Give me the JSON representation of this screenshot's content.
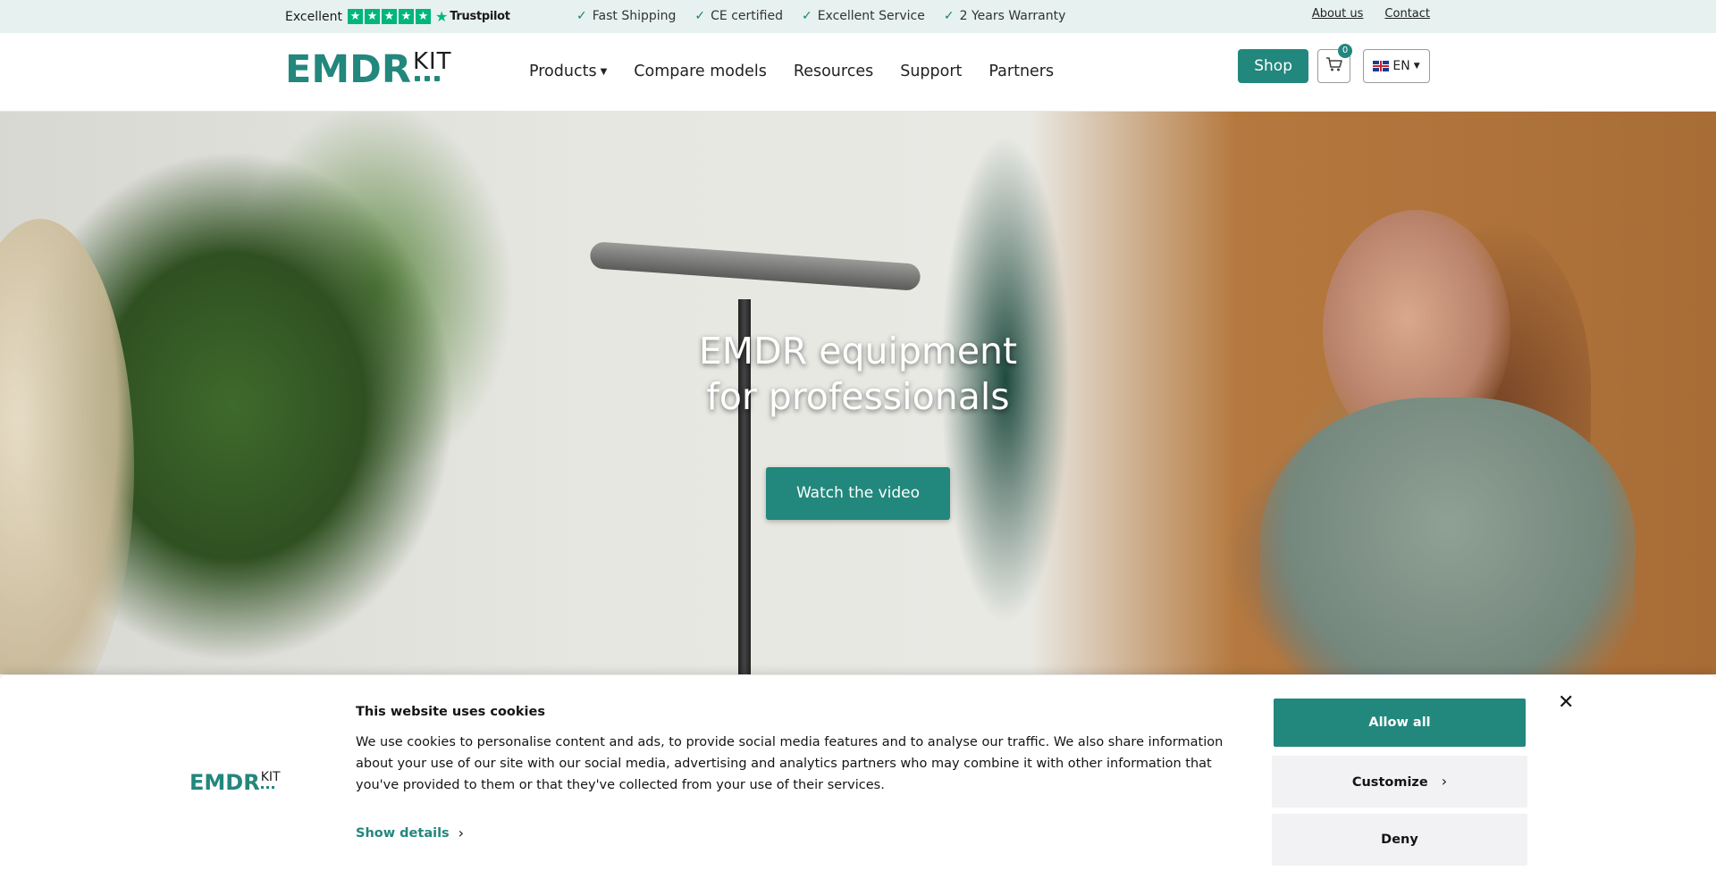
{
  "topbar": {
    "rating_word": "Excellent",
    "trustpilot": "Trustpilot",
    "usps": [
      "Fast Shipping",
      "CE certified",
      "Excellent Service",
      "2 Years Warranty"
    ],
    "links": {
      "about": "About us",
      "contact": "Contact"
    }
  },
  "header": {
    "logo": {
      "main": "EMDR",
      "sub": "KIT"
    },
    "nav": {
      "products": "Products",
      "compare": "Compare models",
      "resources": "Resources",
      "support": "Support",
      "partners": "Partners"
    },
    "shop_label": "Shop",
    "cart_count": "0",
    "language": "EN"
  },
  "hero": {
    "title_line1": "EMDR equipment",
    "title_line2": "for professionals",
    "video_button": "Watch the video"
  },
  "cookie": {
    "logo_main": "EMDR",
    "logo_sub": "KIT",
    "title": "This website uses cookies",
    "text": "We use cookies to personalise content and ads, to provide social media features and to analyse our traffic. We also share information about your use of our site with our social media, advertising and analytics partners who may combine it with other information that you've provided to them or that they've collected from your use of their services.",
    "show_details": "Show details",
    "allow_all": "Allow all",
    "customize": "Customize",
    "deny": "Deny"
  },
  "colors": {
    "brand": "#22877d",
    "topbar_bg": "#e6f1f0",
    "trustpilot_green": "#00b67a"
  }
}
